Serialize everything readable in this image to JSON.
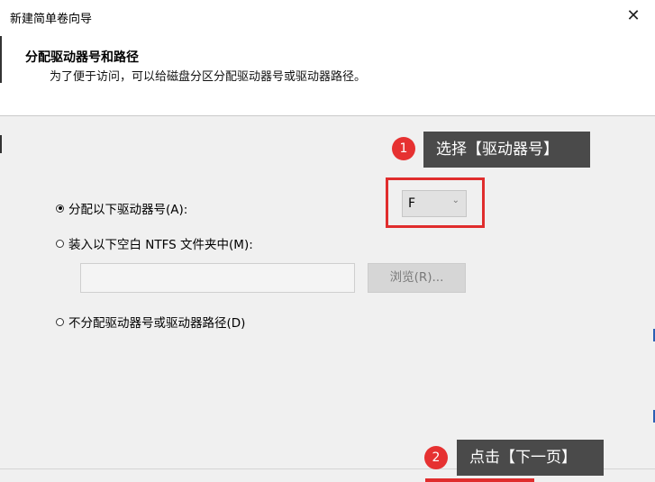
{
  "window": {
    "title": "新建简单卷向导",
    "close_glyph": "✕"
  },
  "header": {
    "title": "分配驱动器号和路径",
    "subtitle": "为了便于访问，可以给磁盘分区分配驱动器号或驱动器路径。"
  },
  "options": {
    "assign_letter_label": "分配以下驱动器号(A):",
    "mount_folder_label": "装入以下空白 NTFS 文件夹中(M):",
    "no_assign_label": "不分配驱动器号或驱动器路径(D)",
    "selected": "assign_letter"
  },
  "drive_letter": {
    "value": "F",
    "caret": "⌄"
  },
  "mount_path": {
    "value": "",
    "browse_label": "浏览(R)..."
  },
  "annotations": {
    "step1_badge": "1",
    "step1_text": "选择【驱动器号】",
    "step2_badge": "2",
    "step2_text": "点击【下一页】"
  },
  "colors": {
    "highlight_red": "#e02d2d",
    "callout_bg": "#4a4a4a",
    "badge_red": "#e63131"
  }
}
